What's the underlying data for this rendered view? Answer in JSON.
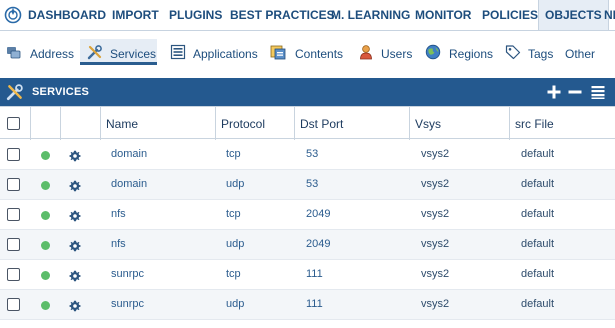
{
  "topnav": {
    "items": [
      {
        "label": "DASHBOARD"
      },
      {
        "label": "IMPORT"
      },
      {
        "label": "PLUGINS"
      },
      {
        "label": "BEST PRACTICES"
      },
      {
        "label": "M. LEARNING"
      },
      {
        "label": "MONITOR"
      },
      {
        "label": "POLICIES"
      },
      {
        "label": "OBJECTS"
      },
      {
        "label": "NE"
      }
    ],
    "active": "OBJECTS"
  },
  "subnav": {
    "tabs": [
      {
        "label": "Address",
        "icon": "address-icon"
      },
      {
        "label": "Services",
        "icon": "services-icon"
      },
      {
        "label": "Applications",
        "icon": "applications-icon"
      },
      {
        "label": "Contents",
        "icon": "contents-icon"
      },
      {
        "label": "Users",
        "icon": "users-icon"
      },
      {
        "label": "Regions",
        "icon": "regions-icon"
      },
      {
        "label": "Tags",
        "icon": "tags-icon"
      },
      {
        "label": "Other"
      }
    ],
    "active": "Services"
  },
  "panel": {
    "title": "SERVICES",
    "tools": [
      "add-icon",
      "remove-icon",
      "menu-icon"
    ]
  },
  "table": {
    "columns": [
      "Name",
      "Protocol",
      "Dst Port",
      "Vsys",
      "src File"
    ],
    "rows": [
      {
        "name": "domain",
        "protocol": "tcp",
        "dst_port": "53",
        "vsys": "vsys2",
        "src_file": "default"
      },
      {
        "name": "domain",
        "protocol": "udp",
        "dst_port": "53",
        "vsys": "vsys2",
        "src_file": "default"
      },
      {
        "name": "nfs",
        "protocol": "tcp",
        "dst_port": "2049",
        "vsys": "vsys2",
        "src_file": "default"
      },
      {
        "name": "nfs",
        "protocol": "udp",
        "dst_port": "2049",
        "vsys": "vsys2",
        "src_file": "default"
      },
      {
        "name": "sunrpc",
        "protocol": "tcp",
        "dst_port": "111",
        "vsys": "vsys2",
        "src_file": "default"
      },
      {
        "name": "sunrpc",
        "protocol": "udp",
        "dst_port": "111",
        "vsys": "vsys2",
        "src_file": "default"
      }
    ]
  },
  "colors": {
    "brand_blue": "#24598f",
    "status_green": "#5cbd6a",
    "link_blue": "#2b5c8e"
  }
}
